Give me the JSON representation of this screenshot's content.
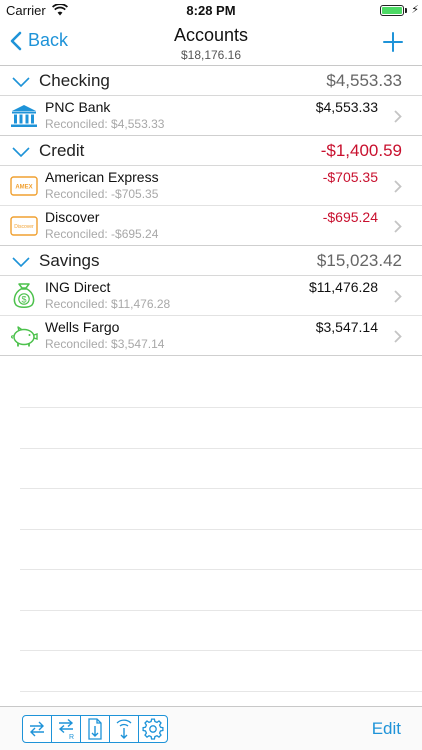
{
  "status_bar": {
    "carrier": "Carrier",
    "time": "8:28 PM"
  },
  "nav": {
    "back_label": "Back",
    "title": "Accounts",
    "subtitle": "$18,176.16"
  },
  "sections": [
    {
      "name": "Checking",
      "total": "$4,553.33",
      "accounts": [
        {
          "name": "PNC Bank",
          "reconciled": "Reconciled: $4,553.33",
          "amount": "$4,553.33",
          "icon": "bank-icon"
        }
      ]
    },
    {
      "name": "Credit",
      "total": "-$1,400.59",
      "accounts": [
        {
          "name": "American Express",
          "reconciled": "Reconciled: -$705.35",
          "amount": "-$705.35",
          "icon": "amex-card-icon",
          "card_text": "AMEX"
        },
        {
          "name": "Discover",
          "reconciled": "Reconciled: -$695.24",
          "amount": "-$695.24",
          "icon": "discover-card-icon",
          "card_text": "Discover"
        }
      ]
    },
    {
      "name": "Savings",
      "total": "$15,023.42",
      "accounts": [
        {
          "name": "ING Direct",
          "reconciled": "Reconciled: $11,476.28",
          "amount": "$11,476.28",
          "icon": "money-bag-icon",
          "bag_text": "$"
        },
        {
          "name": "Wells Fargo",
          "reconciled": "Reconciled: $3,547.14",
          "amount": "$3,547.14",
          "icon": "piggy-bank-icon"
        }
      ]
    }
  ],
  "toolbar": {
    "buttons": [
      "transfer-icon",
      "reconcile-transfer-icon",
      "import-file-icon",
      "wifi-sync-icon",
      "settings-gear-icon"
    ],
    "transfer_letter": "R",
    "edit_label": "Edit"
  },
  "colors": {
    "accent": "#1e93d8",
    "negative": "#c8102e",
    "savings_icon": "#4cc14c",
    "card_icon": "#f0a030"
  }
}
